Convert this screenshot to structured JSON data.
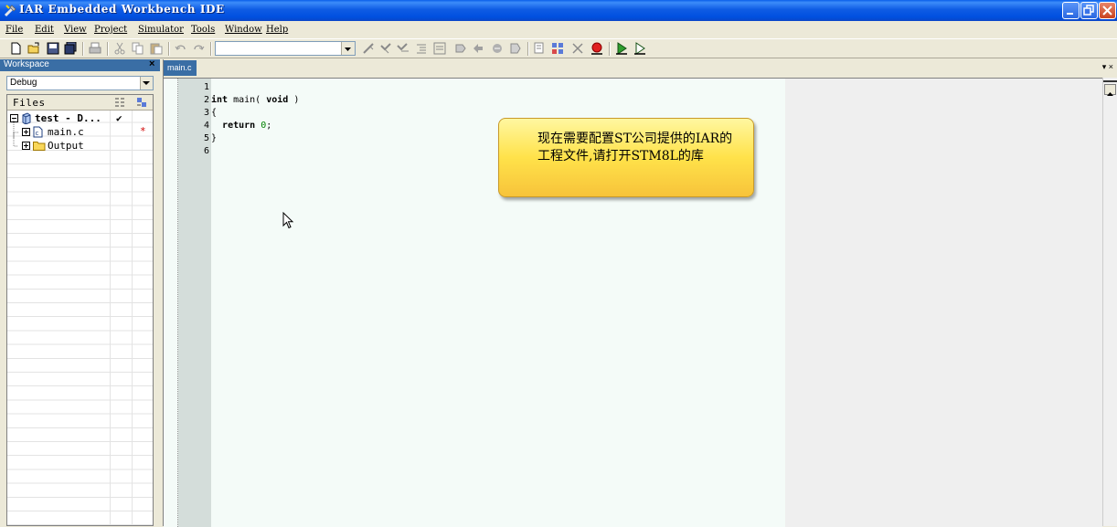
{
  "window": {
    "title": "IAR Embedded Workbench IDE"
  },
  "menu": {
    "items": [
      "File",
      "Edit",
      "View",
      "Project",
      "Simulator",
      "Tools",
      "Window",
      "Help"
    ]
  },
  "toolbar": {
    "config_value": "",
    "icons": [
      "new-file-icon",
      "open-folder-icon",
      "save-icon",
      "save-all-icon",
      "print-icon",
      "cut-icon",
      "copy-icon",
      "paste-icon",
      "undo-icon",
      "redo-icon",
      "find-dropdown-icon",
      "bookmark-icon",
      "check-icon",
      "go-icon",
      "indent-icon",
      "outdent-icon",
      "toggle-breakpoint-icon",
      "navigate-back-icon",
      "navigate-forward-icon",
      "compile-icon",
      "make-icon",
      "stop-build-icon",
      "debug-icon",
      "download-debug-icon"
    ]
  },
  "workspace": {
    "title": "Workspace",
    "config": "Debug",
    "files_header": "Files",
    "tree": [
      {
        "name": "test - D...",
        "check": "✔",
        "level": 0,
        "bold": true
      },
      {
        "name": "main.c",
        "mark": "*",
        "level": 1
      },
      {
        "name": "Output",
        "level": 1
      }
    ]
  },
  "editor": {
    "tab": "main.c",
    "tab_controls": "▾ ×",
    "line_numbers": [
      "1",
      "2",
      "3",
      "4",
      "5",
      "6"
    ],
    "lines": [
      "",
      "int main( void )",
      "{",
      "  return 0;",
      "}",
      ""
    ]
  },
  "callout": {
    "text": "现在需要配置ST公司提供的IAR的工程文件,请打开STM8L的库"
  },
  "colors": {
    "title_bar": "#0054E3",
    "workspace_title": "#3A6EA5",
    "editor_bg": "#F4FBF8",
    "callout_bg": "#FFE24A"
  }
}
